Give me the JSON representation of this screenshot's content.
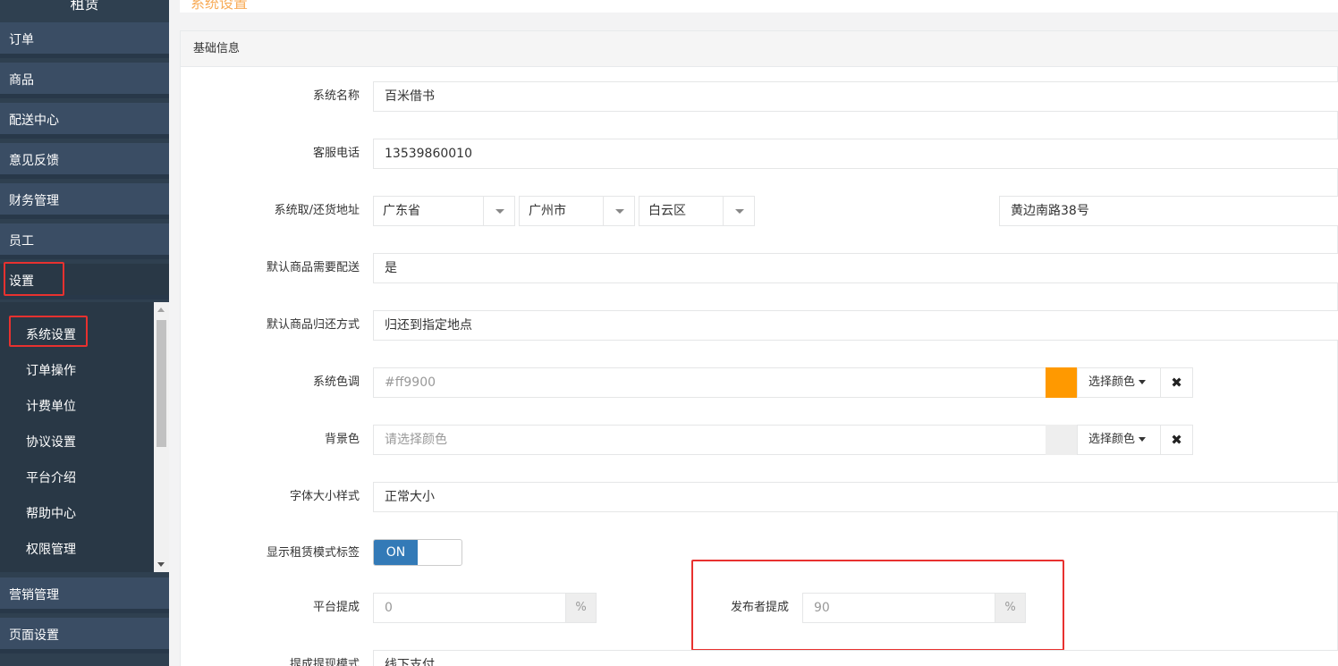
{
  "sidebar": {
    "brand": "租赁",
    "items": [
      {
        "label": "订单"
      },
      {
        "label": "商品"
      },
      {
        "label": "配送中心"
      },
      {
        "label": "意见反馈"
      },
      {
        "label": "财务管理"
      },
      {
        "label": "员工"
      },
      {
        "label": "设置"
      }
    ],
    "sub_items": [
      {
        "label": "系统设置"
      },
      {
        "label": "订单操作"
      },
      {
        "label": "计费单位"
      },
      {
        "label": "协议设置"
      },
      {
        "label": "平台介绍"
      },
      {
        "label": "帮助中心"
      },
      {
        "label": "权限管理"
      }
    ],
    "bottom_items": [
      {
        "label": "营销管理"
      },
      {
        "label": "页面设置"
      }
    ]
  },
  "page": {
    "title": "系统设置"
  },
  "panel": {
    "heading": "基础信息"
  },
  "form": {
    "system_name": {
      "label": "系统名称",
      "value": "百米借书"
    },
    "service_phone": {
      "label": "客服电话",
      "value": "13539860010"
    },
    "address": {
      "label": "系统取/还货地址",
      "province": "广东省",
      "city": "广州市",
      "district": "白云区",
      "detail": "黄边南路38号"
    },
    "need_delivery": {
      "label": "默认商品需要配送",
      "value": "是"
    },
    "return_method": {
      "label": "默认商品归还方式",
      "value": "归还到指定地点"
    },
    "system_color": {
      "label": "系统色调",
      "value": "#ff9900",
      "display": "#ff9900",
      "pick_label": "选择颜色",
      "clear_symbol": "✖"
    },
    "background_color": {
      "label": "背景色",
      "placeholder": "请选择颜色",
      "swatch": "#eeeeee",
      "pick_label": "选择颜色",
      "clear_symbol": "✖"
    },
    "font_size_style": {
      "label": "字体大小样式",
      "value": "正常大小"
    },
    "rental_tag": {
      "label": "显示租赁模式标签",
      "state": "ON"
    },
    "platform_commission": {
      "label": "平台提成",
      "value": "0",
      "unit": "%"
    },
    "publisher_commission": {
      "label": "发布者提成",
      "value": "90",
      "unit": "%"
    },
    "withdraw_mode": {
      "label": "提成提现模式",
      "value": "线下支付"
    }
  },
  "colors": {
    "sidebar_bg": "#2f4050",
    "accent": "#ff9900",
    "toggle_on": "#337ab7",
    "highlight": "#e8312f"
  }
}
